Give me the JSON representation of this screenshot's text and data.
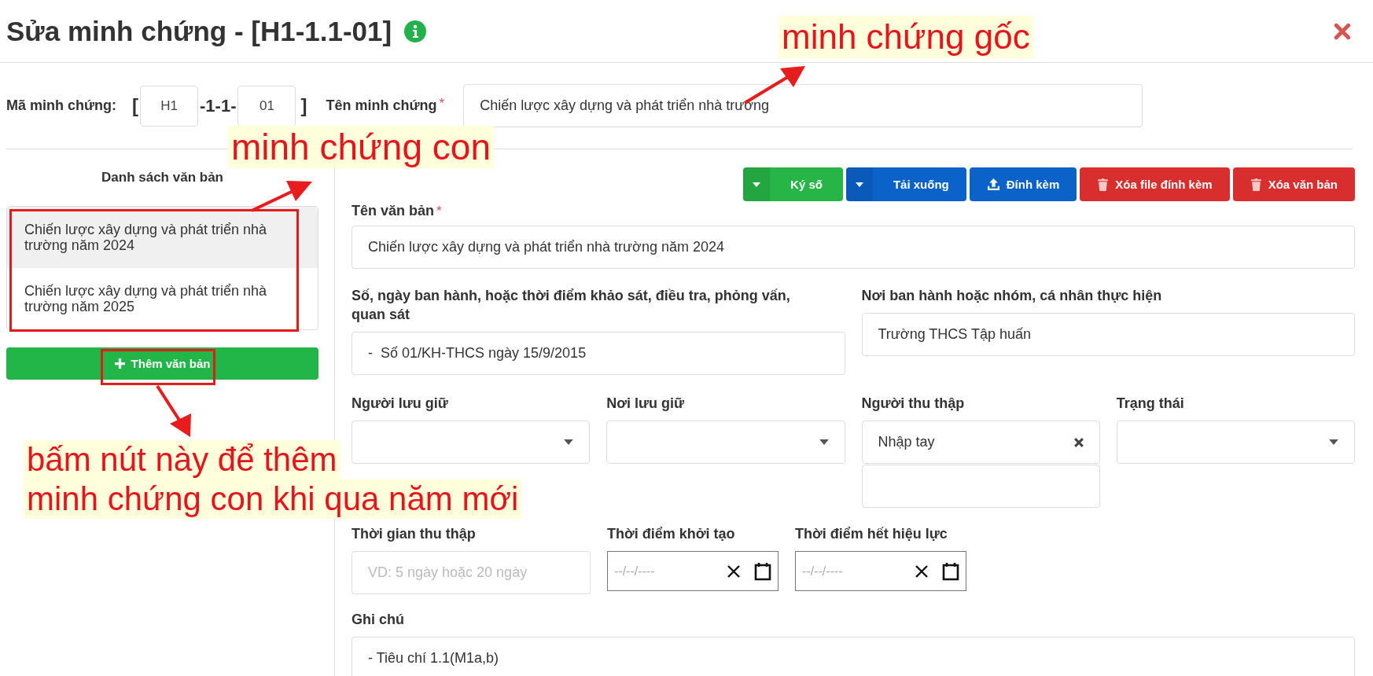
{
  "header": {
    "title": "Sửa minh chứng - [H1-1.1-01]"
  },
  "code_row": {
    "label": "Mã minh chứng:",
    "open_bracket": "[",
    "prefix": "H1",
    "separator": "-1-1-",
    "suffix": "01",
    "close_bracket": "]",
    "name_label": "Tên minh chứng",
    "required": "*",
    "name_value": "Chiến lược xây dựng và phát triển nhà trường"
  },
  "document_list": {
    "title": "Danh sách văn bản",
    "items": [
      {
        "label": "Chiến lược xây dựng và phát triển nhà trường năm 2024",
        "selected": true
      },
      {
        "label": "Chiến lược xây dựng và phát triển nhà trường năm 2025",
        "selected": false
      }
    ],
    "add_button": "Thêm văn bản"
  },
  "toolbar": [
    {
      "label": "Ký số",
      "kind": "split",
      "color": "#26b546"
    },
    {
      "label": "Tải xuống",
      "kind": "split",
      "color": "#0b63c9"
    },
    {
      "label": "Đính kèm",
      "kind": "upload",
      "color": "#0b63c9"
    },
    {
      "label": "Xóa file đính kèm",
      "kind": "trash",
      "color": "#d92e2e"
    },
    {
      "label": "Xóa văn bản",
      "kind": "trash",
      "color": "#d92e2e"
    }
  ],
  "document_name": {
    "label": "Tên văn bản",
    "required": "*",
    "value": "Chiến lược xây dựng và phát triển nhà trường năm 2024"
  },
  "issue_info": {
    "label": "Số, ngày ban hành, hoặc thời điểm khảo sát, điều tra, phỏng vấn, quan sát",
    "value": "-  Số 01/KH-THCS ngày 15/9/2015"
  },
  "issuer": {
    "label": "Nơi ban hành hoặc nhóm, cá nhân thực hiện",
    "value": "Trường THCS Tập huấn"
  },
  "selects": [
    {
      "label": "Người lưu giữ",
      "kind": "dropdown"
    },
    {
      "label": "Nơi lưu giữ",
      "kind": "dropdown"
    },
    {
      "label": "Người thu thập",
      "kind": "tags",
      "value": "Nhập tay"
    },
    {
      "label": "Trạng thái",
      "kind": "dropdown"
    }
  ],
  "collect_time": {
    "label": "Thời gian thu thập",
    "placeholder": "VD: 5 ngày hoặc 20 ngày"
  },
  "dates": [
    {
      "label": "Thời điểm khởi tạo",
      "placeholder": "--/--/----"
    },
    {
      "label": "Thời điểm hết hiệu lực",
      "placeholder": "--/--/----"
    }
  ],
  "note": {
    "label": "Ghi chú",
    "value": "- Tiêu chí 1.1(M1a,b)"
  },
  "annotations": [
    {
      "lines": [
        "minh chứng gốc"
      ]
    },
    {
      "lines": [
        "minh chứng con"
      ]
    },
    {
      "lines": [
        "bấm nút này để thêm",
        "minh chứng con khi qua năm mới"
      ]
    }
  ]
}
